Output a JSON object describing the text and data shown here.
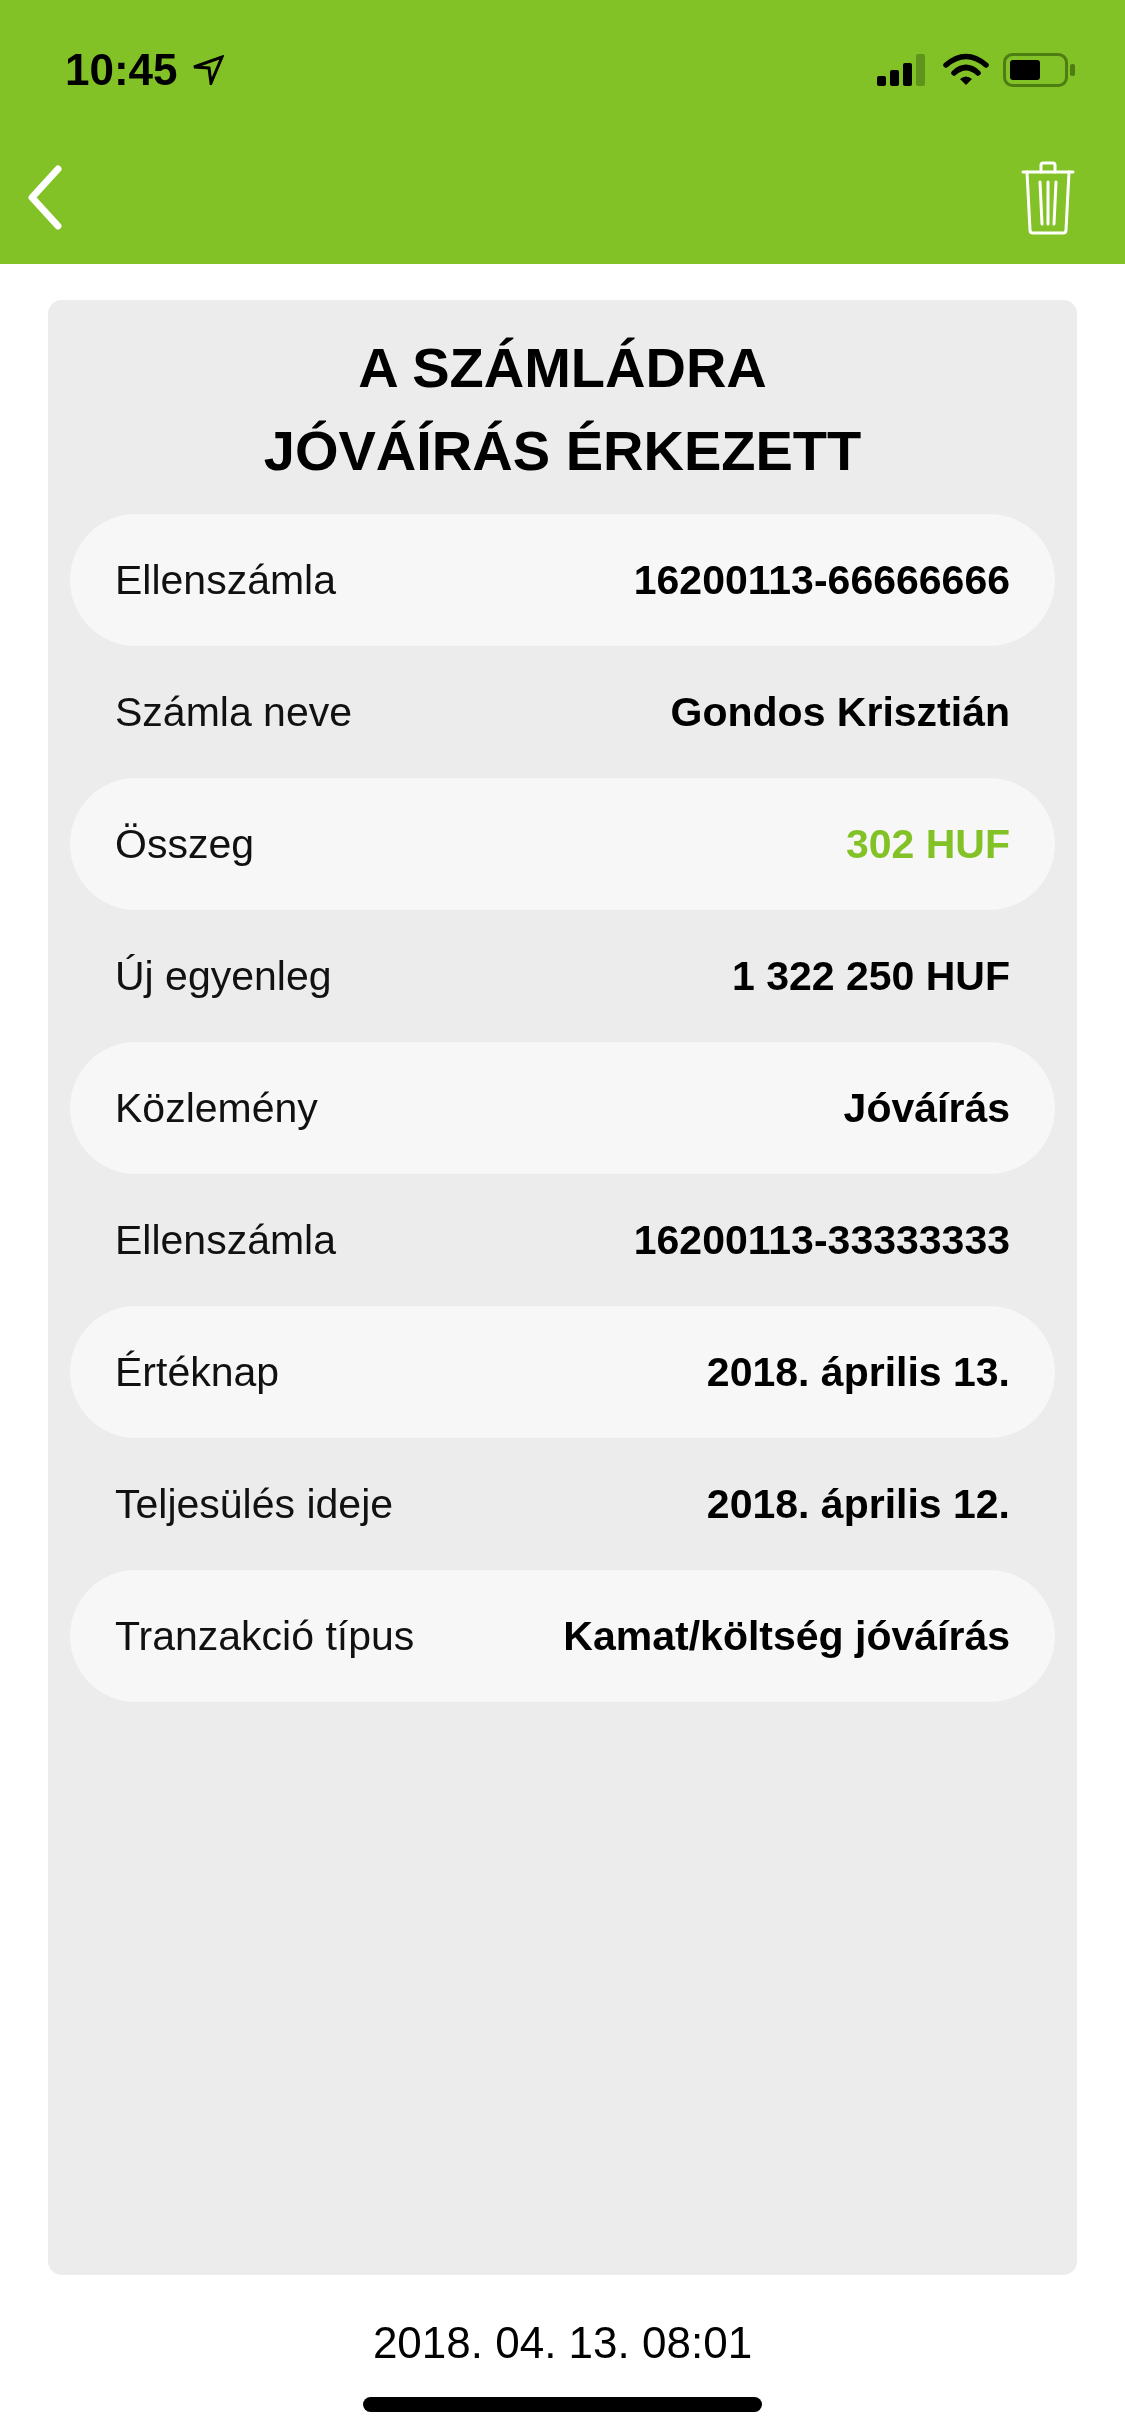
{
  "status_bar": {
    "time": "10:45"
  },
  "notification": {
    "title_lines": [
      "A SZÁMLÁDRA",
      "JÓVÁÍRÁS ÉRKEZETT"
    ],
    "rows": [
      {
        "label": "Ellenszámla",
        "value": "16200113-66666666",
        "kind": "text"
      },
      {
        "label": "Számla neve",
        "value": "Gondos Krisztián",
        "kind": "text"
      },
      {
        "label": "Összeg",
        "value": "302 HUF",
        "kind": "amount"
      },
      {
        "label": "Új egyenleg",
        "value": "1 322 250 HUF",
        "kind": "text"
      },
      {
        "label": "Közlemény",
        "value": "Jóváírás",
        "kind": "text"
      },
      {
        "label": "Ellenszámla",
        "value": "16200113-33333333",
        "kind": "text"
      },
      {
        "label": "Értéknap",
        "value": "2018. április 13.",
        "kind": "text"
      },
      {
        "label": "Teljesülés ideje",
        "value": "2018. április 12.",
        "kind": "text"
      },
      {
        "label": "Tranzakció típus",
        "value": "Kamat/költség jóváírás",
        "kind": "text"
      }
    ]
  },
  "timestamp": "2018. 04. 13. 08:01"
}
